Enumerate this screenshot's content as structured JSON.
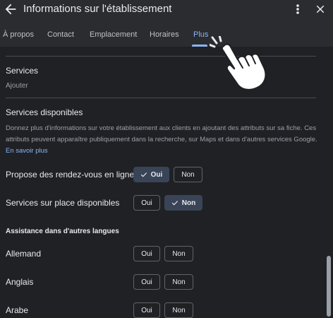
{
  "header": {
    "title": "Informations sur l'établissement",
    "back_icon": "arrow-left-icon",
    "menu_icon": "more-vert-icon",
    "close_icon": "close-icon"
  },
  "tabs": [
    {
      "label": "À propos",
      "active": false
    },
    {
      "label": "Contact",
      "active": false
    },
    {
      "label": "Emplacement",
      "active": false
    },
    {
      "label": "Horaires",
      "active": false
    },
    {
      "label": "Plus",
      "active": true
    }
  ],
  "services": {
    "title": "Services",
    "action": "Ajouter"
  },
  "services_disponibles": {
    "title": "Services disponibles",
    "description": "Donnez plus d'informations sur votre établissement aux clients en ajoutant des attributs sur sa fiche. Ces attributs peuvent apparaître publiquement dans la recherche, sur Maps et dans d'autres services Google.",
    "learn_more": "En savoir plus"
  },
  "attributes": [
    {
      "label": "Propose des rendez-vous en ligne",
      "yes": "Oui",
      "no": "Non",
      "selected": "Oui"
    },
    {
      "label": "Services sur place disponibles",
      "yes": "Oui",
      "no": "Non",
      "selected": "Non"
    }
  ],
  "languages": {
    "title": "Assistance dans d'autres langues",
    "items": [
      {
        "label": "Allemand",
        "yes": "Oui",
        "no": "Non",
        "selected": null
      },
      {
        "label": "Anglais",
        "yes": "Oui",
        "no": "Non",
        "selected": null
      },
      {
        "label": "Arabe",
        "yes": "Oui",
        "no": "Non",
        "selected": null
      }
    ]
  },
  "colors": {
    "background": "#202124",
    "header": "#2b2c2f",
    "accent": "#8ab4f8",
    "selected_chip": "#394457"
  },
  "cursor_icon": "hand-pointer-icon"
}
